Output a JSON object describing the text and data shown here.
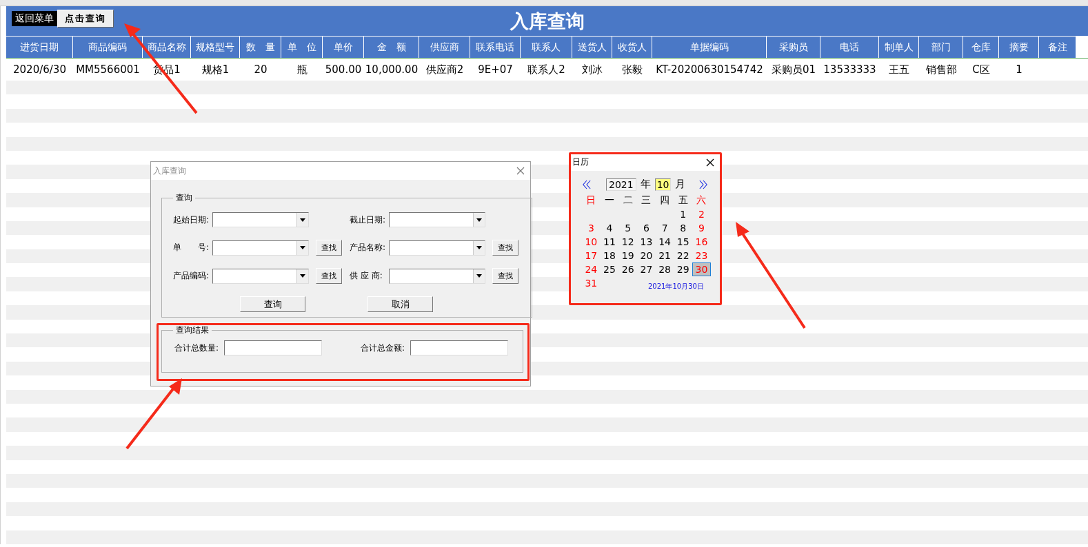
{
  "sheet": {
    "buttons": [
      {
        "label": "返回菜单",
        "kind": "dark"
      },
      {
        "label": "点击查询",
        "kind": "raised"
      }
    ],
    "title": "入库查询",
    "columns": [
      "进货日期",
      "商品编码",
      "商品名称",
      "规格型号",
      "数　量",
      "单　位",
      "单价",
      "金　额",
      "供应商",
      "联系电话",
      "联系人",
      "送货人",
      "收货人",
      "单据编码",
      "采购员",
      "电话",
      "制单人",
      "部门",
      "仓库",
      "摘要",
      "备注"
    ],
    "rows": [
      [
        "2020/6/30",
        "MM5566001",
        "货品1",
        "规格1",
        "20",
        "瓶",
        "500.00",
        "10,000.00",
        "供应商2",
        "9E+07",
        "联系人2",
        "刘冰",
        "张毅",
        "KT-20200630154742",
        "采购员01",
        "13533333",
        "王五",
        "销售部",
        "C区",
        "1"
      ]
    ]
  },
  "query_dialog": {
    "title": "入库查询",
    "group": "查询",
    "fields": [
      {
        "label": "起始日期:"
      },
      {
        "label": "截止日期:"
      },
      {
        "label": "单　　号:",
        "find": "查找"
      },
      {
        "label": "产品名称:",
        "find": "查找"
      },
      {
        "label": "产品编码:",
        "find": "查找"
      },
      {
        "label": "供 应 商:",
        "find": "查找"
      }
    ],
    "buttons": [
      "查询",
      "取消"
    ],
    "result_group": "查询结果",
    "result_fields": [
      "合计总数量:",
      "合计总金额:"
    ]
  },
  "calendar": {
    "title": "日历",
    "year": "2021",
    "year_label": "年",
    "month": "10",
    "month_label": "月",
    "weekdays": [
      {
        "label": "日",
        "weekend": true
      },
      {
        "label": "一",
        "weekend": false
      },
      {
        "label": "二",
        "weekend": false
      },
      {
        "label": "三",
        "weekend": false
      },
      {
        "label": "四",
        "weekend": false
      },
      {
        "label": "五",
        "weekend": false
      },
      {
        "label": "六",
        "weekend": true
      }
    ],
    "weeks": [
      [
        {
          "kind": "blank"
        },
        {
          "kind": "blank"
        },
        {
          "kind": "blank"
        },
        {
          "kind": "blank"
        },
        {
          "kind": "blank"
        },
        {
          "kind": "day",
          "day": "1",
          "weekend": false,
          "selected": false
        },
        {
          "kind": "day",
          "day": "2",
          "weekend": true,
          "selected": false
        }
      ],
      [
        {
          "kind": "day",
          "day": "3",
          "weekend": true,
          "selected": false
        },
        {
          "kind": "day",
          "day": "4",
          "weekend": false,
          "selected": false
        },
        {
          "kind": "day",
          "day": "5",
          "weekend": false,
          "selected": false
        },
        {
          "kind": "day",
          "day": "6",
          "weekend": false,
          "selected": false
        },
        {
          "kind": "day",
          "day": "7",
          "weekend": false,
          "selected": false
        },
        {
          "kind": "day",
          "day": "8",
          "weekend": false,
          "selected": false
        },
        {
          "kind": "day",
          "day": "9",
          "weekend": true,
          "selected": false
        }
      ],
      [
        {
          "kind": "day",
          "day": "10",
          "weekend": true,
          "selected": false
        },
        {
          "kind": "day",
          "day": "11",
          "weekend": false,
          "selected": false
        },
        {
          "kind": "day",
          "day": "12",
          "weekend": false,
          "selected": false
        },
        {
          "kind": "day",
          "day": "13",
          "weekend": false,
          "selected": false
        },
        {
          "kind": "day",
          "day": "14",
          "weekend": false,
          "selected": false
        },
        {
          "kind": "day",
          "day": "15",
          "weekend": false,
          "selected": false
        },
        {
          "kind": "day",
          "day": "16",
          "weekend": true,
          "selected": false
        }
      ],
      [
        {
          "kind": "day",
          "day": "17",
          "weekend": true,
          "selected": false
        },
        {
          "kind": "day",
          "day": "18",
          "weekend": false,
          "selected": false
        },
        {
          "kind": "day",
          "day": "19",
          "weekend": false,
          "selected": false
        },
        {
          "kind": "day",
          "day": "20",
          "weekend": false,
          "selected": false
        },
        {
          "kind": "day",
          "day": "21",
          "weekend": false,
          "selected": false
        },
        {
          "kind": "day",
          "day": "22",
          "weekend": false,
          "selected": false
        },
        {
          "kind": "day",
          "day": "23",
          "weekend": true,
          "selected": false
        }
      ],
      [
        {
          "kind": "day",
          "day": "24",
          "weekend": true,
          "selected": false
        },
        {
          "kind": "day",
          "day": "25",
          "weekend": false,
          "selected": false
        },
        {
          "kind": "day",
          "day": "26",
          "weekend": false,
          "selected": false
        },
        {
          "kind": "day",
          "day": "27",
          "weekend": false,
          "selected": false
        },
        {
          "kind": "day",
          "day": "28",
          "weekend": false,
          "selected": false
        },
        {
          "kind": "day",
          "day": "29",
          "weekend": false,
          "selected": false
        },
        {
          "kind": "day",
          "day": "30",
          "weekend": true,
          "selected": true
        }
      ],
      [
        {
          "kind": "day",
          "day": "31",
          "weekend": true,
          "selected": false
        }
      ]
    ],
    "footer": "2021年10月30日"
  }
}
